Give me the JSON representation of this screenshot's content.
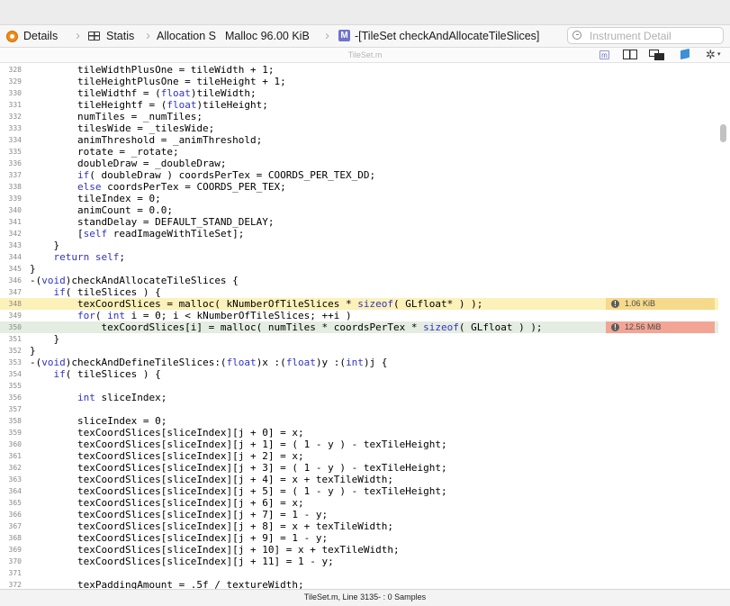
{
  "jumpbar": {
    "details_label": "Details",
    "statistics_label": "Statis",
    "allocation_label": "Allocation S",
    "malloc_label": "Malloc 96.00 KiB",
    "method_label": "-[TileSet checkAndAllocateTileSlices]",
    "search_placeholder": "Instrument Detail",
    "method_icon_letter": "M"
  },
  "toolbar": {
    "file_label": "TileSet.m",
    "m_badge": "m",
    "gear_glyph": "✲",
    "caret_glyph": "▾"
  },
  "editor": {
    "lines": [
      {
        "n": "328",
        "code": "        tileWidthPlusOne = tileWidth + 1;"
      },
      {
        "n": "329",
        "code": "        tileHeightPlusOne = tileHeight + 1;"
      },
      {
        "n": "330",
        "code": "        tileWidthf = (float)tileWidth;"
      },
      {
        "n": "331",
        "code": "        tileHeightf = (float)tileHeight;"
      },
      {
        "n": "332",
        "code": "        numTiles = _numTiles;"
      },
      {
        "n": "333",
        "code": "        tilesWide = _tilesWide;"
      },
      {
        "n": "334",
        "code": "        animThreshold = _animThreshold;"
      },
      {
        "n": "335",
        "code": "        rotate = _rotate;"
      },
      {
        "n": "336",
        "code": "        doubleDraw = _doubleDraw;"
      },
      {
        "n": "337",
        "code": "        if( doubleDraw ) coordsPerTex = COORDS_PER_TEX_DD;"
      },
      {
        "n": "338",
        "code": "        else coordsPerTex = COORDS_PER_TEX;"
      },
      {
        "n": "339",
        "code": "        tileIndex = 0;"
      },
      {
        "n": "340",
        "code": "        animCount = 0.0;"
      },
      {
        "n": "341",
        "code": "        standDelay = DEFAULT_STAND_DELAY;"
      },
      {
        "n": "342",
        "code": "        [self readImageWithTileSet];"
      },
      {
        "n": "343",
        "code": "    }"
      },
      {
        "n": "344",
        "code": "    return self;"
      },
      {
        "n": "345",
        "code": "}"
      },
      {
        "n": "346",
        "code": "-(void)checkAndAllocateTileSlices {"
      },
      {
        "n": "347",
        "code": "    if( tileSlices ) {"
      },
      {
        "n": "348",
        "code": "        texCoordSlices = malloc( kNumberOfTileSlices * sizeof( GLfloat* ) );",
        "highlight": "yellow",
        "annotation": "1.06 KiB"
      },
      {
        "n": "349",
        "code": "        for( int i = 0; i < kNumberOfTileSlices; ++i )"
      },
      {
        "n": "350",
        "code": "            texCoordSlices[i] = malloc( numTiles * coordsPerTex * sizeof( GLfloat ) );",
        "highlight": "green",
        "annotation": "12.56 MiB"
      },
      {
        "n": "351",
        "code": "    }"
      },
      {
        "n": "352",
        "code": "}"
      },
      {
        "n": "353",
        "code": "-(void)checkAndDefineTileSlices:(float)x :(float)y :(int)j {"
      },
      {
        "n": "354",
        "code": "    if( tileSlices ) {"
      },
      {
        "n": "355",
        "code": ""
      },
      {
        "n": "356",
        "code": "        int sliceIndex;"
      },
      {
        "n": "357",
        "code": ""
      },
      {
        "n": "358",
        "code": "        sliceIndex = 0;"
      },
      {
        "n": "359",
        "code": "        texCoordSlices[sliceIndex][j + 0] = x;"
      },
      {
        "n": "360",
        "code": "        texCoordSlices[sliceIndex][j + 1] = ( 1 - y ) - texTileHeight;"
      },
      {
        "n": "361",
        "code": "        texCoordSlices[sliceIndex][j + 2] = x;"
      },
      {
        "n": "362",
        "code": "        texCoordSlices[sliceIndex][j + 3] = ( 1 - y ) - texTileHeight;"
      },
      {
        "n": "363",
        "code": "        texCoordSlices[sliceIndex][j + 4] = x + texTileWidth;"
      },
      {
        "n": "364",
        "code": "        texCoordSlices[sliceIndex][j + 5] = ( 1 - y ) - texTileHeight;"
      },
      {
        "n": "365",
        "code": "        texCoordSlices[sliceIndex][j + 6] = x;"
      },
      {
        "n": "366",
        "code": "        texCoordSlices[sliceIndex][j + 7] = 1 - y;"
      },
      {
        "n": "367",
        "code": "        texCoordSlices[sliceIndex][j + 8] = x + texTileWidth;"
      },
      {
        "n": "368",
        "code": "        texCoordSlices[sliceIndex][j + 9] = 1 - y;"
      },
      {
        "n": "369",
        "code": "        texCoordSlices[sliceIndex][j + 10] = x + texTileWidth;"
      },
      {
        "n": "370",
        "code": "        texCoordSlices[sliceIndex][j + 11] = 1 - y;"
      },
      {
        "n": "371",
        "code": ""
      },
      {
        "n": "372",
        "code": "        texPaddingAmount = .5f / textureWidth;"
      }
    ],
    "keywords": [
      "float",
      "if",
      "else",
      "self",
      "return",
      "void",
      "for",
      "int",
      "sizeof"
    ],
    "colors": {
      "keyword": "#2f33c7",
      "highlight_yellow": "#fbf1b9",
      "highlight_green": "#e5ede2",
      "annotation_yellow": "#f6d98a",
      "annotation_red": "#f3a595"
    }
  },
  "statusbar": {
    "text": "TileSet.m, Line 3135- : 0 Samples"
  }
}
